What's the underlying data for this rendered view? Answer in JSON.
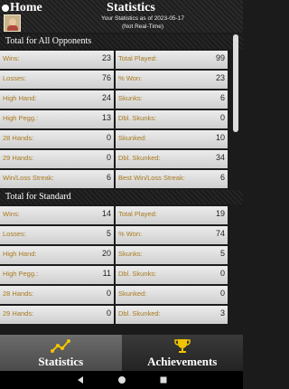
{
  "header": {
    "home_label": "Home",
    "title": "Statistics",
    "subtitle_line1": "Your Statistics as of 2023-05-17",
    "subtitle_line2": "(Not Real-Time)"
  },
  "sections": [
    {
      "title": "Total for All Opponents",
      "rows": [
        {
          "left_label": "Wins:",
          "left_value": "23",
          "right_label": "Total Played:",
          "right_value": "99"
        },
        {
          "left_label": "Losses:",
          "left_value": "76",
          "right_label": "% Won:",
          "right_value": "23"
        },
        {
          "left_label": "High Hand:",
          "left_value": "24",
          "right_label": "Skunks:",
          "right_value": "6"
        },
        {
          "left_label": "High Pegg.:",
          "left_value": "13",
          "right_label": "Dbl. Skunks:",
          "right_value": "0"
        },
        {
          "left_label": "28 Hands:",
          "left_value": "0",
          "right_label": "Skunked:",
          "right_value": "10"
        },
        {
          "left_label": "29 Hands:",
          "left_value": "0",
          "right_label": "Dbl. Skunked:",
          "right_value": "34"
        },
        {
          "left_label": "Win/Loss Streak:",
          "left_value": "6",
          "right_label": "Best Win/Loss Streak:",
          "right_value": "6"
        }
      ]
    },
    {
      "title": "Total for Standard",
      "rows": [
        {
          "left_label": "Wins:",
          "left_value": "14",
          "right_label": "Total Played:",
          "right_value": "19"
        },
        {
          "left_label": "Losses:",
          "left_value": "5",
          "right_label": "% Won:",
          "right_value": "74"
        },
        {
          "left_label": "High Hand:",
          "left_value": "20",
          "right_label": "Skunks:",
          "right_value": "5"
        },
        {
          "left_label": "High Pegg.:",
          "left_value": "11",
          "right_label": "Dbl. Skunks:",
          "right_value": "0"
        },
        {
          "left_label": "28 Hands:",
          "left_value": "0",
          "right_label": "Skunked:",
          "right_value": "0"
        },
        {
          "left_label": "29 Hands:",
          "left_value": "0",
          "right_label": "Dbl. Skunked:",
          "right_value": "3"
        }
      ]
    }
  ],
  "tabs": [
    {
      "label": "Statistics",
      "icon": "line-chart-icon",
      "active": true
    },
    {
      "label": "Achievements",
      "icon": "trophy-icon",
      "active": false
    }
  ],
  "navbar": [
    "back-icon",
    "home-circle-icon",
    "recents-icon"
  ]
}
